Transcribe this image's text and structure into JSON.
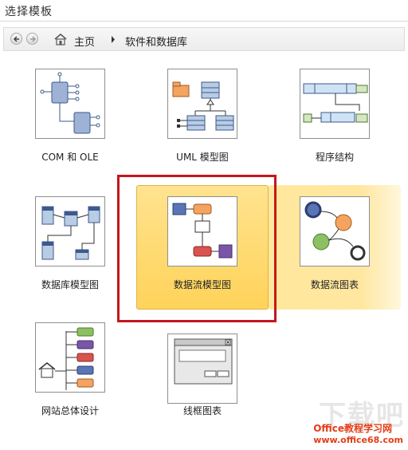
{
  "window": {
    "title": "选择模板"
  },
  "breadcrumb": {
    "home": "主页",
    "current": "软件和数据库"
  },
  "templates": [
    {
      "label": "COM 和 OLE",
      "icon": "com-ole-template-icon"
    },
    {
      "label": "UML 模型图",
      "icon": "uml-template-icon"
    },
    {
      "label": "程序结构",
      "icon": "program-structure-template-icon"
    },
    {
      "label": "数据库模型图",
      "icon": "database-model-template-icon"
    },
    {
      "label": "数据流模型图",
      "icon": "data-flow-model-template-icon",
      "selected": true
    },
    {
      "label": "数据流图表",
      "icon": "data-flow-diagram-template-icon",
      "hovered": true
    },
    {
      "label": "网站总体设计",
      "icon": "website-design-template-icon"
    },
    {
      "label": "线框图表",
      "icon": "wireframe-template-icon"
    }
  ],
  "watermark": {
    "brand": "Office教程学习网",
    "url": "www.office68.com",
    "big_text": "下载吧"
  },
  "colors": {
    "selected": "#ffd35a",
    "highlight_frame": "#c5161d"
  }
}
